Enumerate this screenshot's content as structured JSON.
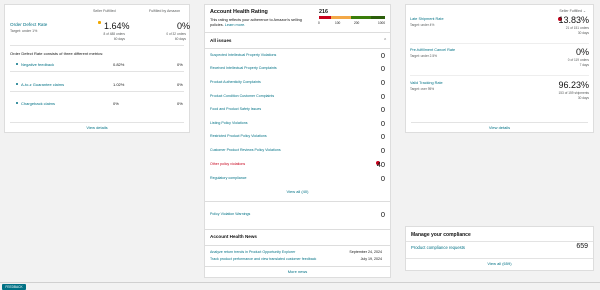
{
  "left": {
    "col_seller": "Seller Fulfilled",
    "col_amazon": "Fulfilled by Amazon",
    "odr_title": "Order Defect Rate",
    "odr_target": "Target: under 1%",
    "odr_pct": "1.64%",
    "odr_sub1": "8 of 488 orders",
    "odr_sub2": "60 days",
    "fba_pct": "0%",
    "fba_sub1": "0 of 32 orders",
    "fba_sub2": "60 days",
    "consists": "Order Defect Rate consists of three different metrics:",
    "metrics": [
      {
        "name": "Negative feedback",
        "v1": "0.82%",
        "v2": "0%"
      },
      {
        "name": "A-to-z Guarantee claims",
        "v1": "1.02%",
        "v2": "0%"
      },
      {
        "name": "Chargeback claims",
        "v1": "0%",
        "v2": "0%"
      }
    ],
    "view_details": "View details"
  },
  "mid": {
    "ahr_title": "Account Health Rating",
    "ahr_desc": "This rating reflects your adherence to Amazon's selling policies.",
    "learn_more": "Learn more.",
    "ahr_score": "216",
    "ticks": [
      "0",
      "100",
      "200",
      "1000"
    ],
    "colors": {
      "red": "#c7001a",
      "yellow": "#f3a847",
      "green": "#3a7d0a",
      "darkgreen": "#2b5e0b"
    },
    "all_issues": "All issues",
    "issues": [
      {
        "name": "Suspected Intellectual Property Violations",
        "count": "0"
      },
      {
        "name": "Received Intellectual Property Complaints",
        "count": "0"
      },
      {
        "name": "Product Authenticity Complaints",
        "count": "0"
      },
      {
        "name": "Product Condition Customer Complaints",
        "count": "0"
      },
      {
        "name": "Food and Product Safety Issues",
        "count": "0"
      },
      {
        "name": "Listing Policy Violations",
        "count": "0"
      },
      {
        "name": "Restricted Product Policy Violations",
        "count": "0"
      },
      {
        "name": "Customer Product Reviews Policy Violations",
        "count": "0"
      },
      {
        "name": "Other policy violations",
        "count": "40",
        "alert": true
      },
      {
        "name": "Regulatory compliance",
        "count": "0"
      }
    ],
    "view_all": "View all (40)",
    "policy_warnings": {
      "name": "Policy Violation Warnings",
      "count": "0"
    },
    "news_title": "Account Health News",
    "news": [
      {
        "text": "Analyze return trends in Product Opportunity Explorer",
        "date": "September 24, 2024"
      },
      {
        "text": "Track product performance and view translated customer feedback",
        "date": "July 19, 2024"
      }
    ],
    "more_news": "More news"
  },
  "right": {
    "dropdown": "Seller Fulfilled",
    "boxes": [
      {
        "name": "Late Shipment Rate",
        "target": "Target: under 4%",
        "value": "13.83%",
        "s1": "21 of 151 orders",
        "s2": "30 days",
        "alert": true
      },
      {
        "name": "Pre-fulfillment Cancel Rate",
        "target": "Target: under 2.5%",
        "value": "0%",
        "s1": "0 of 119 orders",
        "s2": "7 days",
        "alert": false
      },
      {
        "name": "Valid Tracking Rate",
        "target": "Target: over 95%",
        "value": "96.23%",
        "s1": "153 of 159 shipments",
        "s2": "30 days",
        "alert": false
      }
    ],
    "view_details": "View details",
    "compliance_title": "Manage your compliance",
    "compliance_item": "Product compliance requests",
    "compliance_count": "659",
    "view_all": "View all (659)"
  },
  "feedback": "FEEDBACK"
}
